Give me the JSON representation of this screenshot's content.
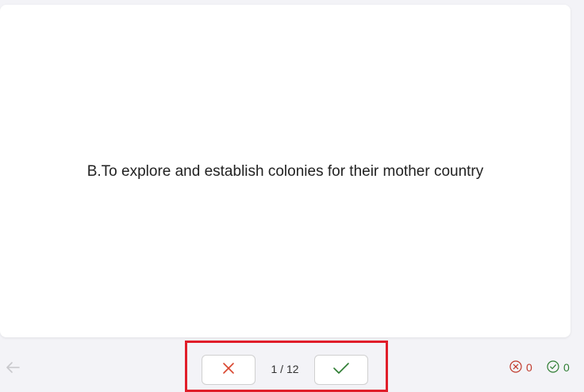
{
  "card": {
    "text": "B.To explore and establish colonies for their mother country"
  },
  "navigation": {
    "back_icon": "arrow-left-icon",
    "wrong_icon": "x-icon",
    "right_icon": "checkmark-icon",
    "counter": "1 / 12"
  },
  "score": {
    "wrong_count": "0",
    "right_count": "0",
    "wrong_icon": "x-circle-icon",
    "right_icon": "check-circle-icon"
  },
  "colors": {
    "wrong": "#d9462f",
    "right": "#2e7d32",
    "highlight": "#e01e2a",
    "background": "#f3f3f7"
  }
}
